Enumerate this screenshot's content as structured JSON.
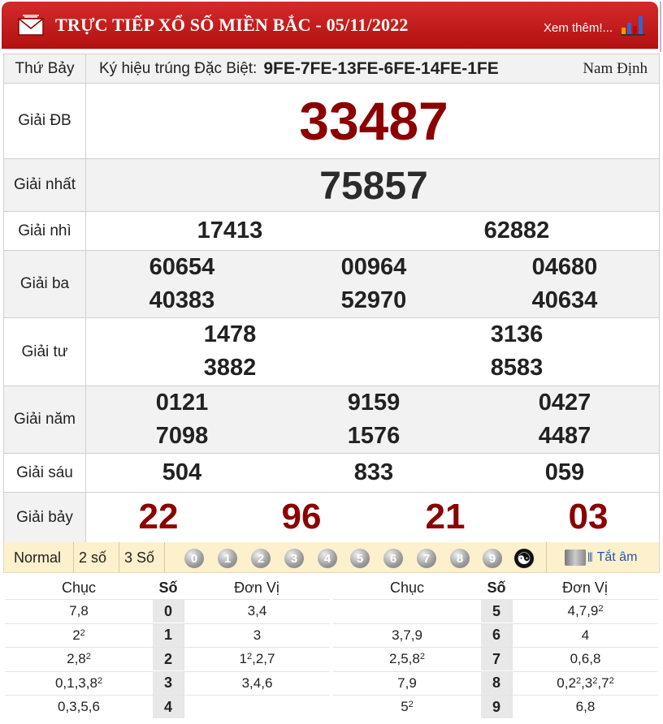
{
  "header": {
    "title": "TRỰC TIẾP XỔ SỐ MIỀN BẮC - 05/11/2022",
    "more_link": "Xem thêm!..."
  },
  "info": {
    "weekday": "Thứ Bảy",
    "symbol_label": "Ký hiệu trúng Đặc Biệt:",
    "symbol_value": "9FE-7FE-13FE-6FE-14FE-1FE",
    "province": "Nam Định"
  },
  "prizes": {
    "db": {
      "label": "Giải ĐB",
      "numbers": [
        "33487"
      ]
    },
    "nhat": {
      "label": "Giải nhất",
      "numbers": [
        "75857"
      ]
    },
    "nhi": {
      "label": "Giải nhì",
      "numbers": [
        "17413",
        "62882"
      ]
    },
    "ba": {
      "label": "Giải ba",
      "numbers": [
        "60654",
        "00964",
        "04680",
        "40383",
        "52970",
        "40634"
      ]
    },
    "tu": {
      "label": "Giải tư",
      "numbers": [
        "1478",
        "3136",
        "3882",
        "8583"
      ]
    },
    "nam": {
      "label": "Giải năm",
      "numbers": [
        "0121",
        "9159",
        "0427",
        "7098",
        "1576",
        "4487"
      ]
    },
    "sau": {
      "label": "Giải sáu",
      "numbers": [
        "504",
        "833",
        "059"
      ]
    },
    "bay": {
      "label": "Giải bảy",
      "numbers": [
        "22",
        "96",
        "21",
        "03"
      ]
    }
  },
  "toolbar": {
    "modes": [
      "Normal",
      "2 số",
      "3 Số"
    ],
    "balls": [
      "0",
      "1",
      "2",
      "3",
      "4",
      "5",
      "6",
      "7",
      "8",
      "9"
    ],
    "mute_label": "Tắt âm",
    "yinyang_icon": "yin-yang-icon",
    "mute_icon": "sound-bars-icon"
  },
  "loto": {
    "headers": {
      "chuc": "Chục",
      "so": "Số",
      "donvi": "Đơn Vị"
    },
    "left": [
      {
        "chuc": "7,8",
        "so": "0",
        "donvi": "3,4"
      },
      {
        "chuc": "2²",
        "so": "1",
        "donvi": "3"
      },
      {
        "chuc": "2,8²",
        "so": "2",
        "donvi": "1²,2,7"
      },
      {
        "chuc": "0,1,3,8²",
        "so": "3",
        "donvi": "3,4,6"
      },
      {
        "chuc": "0,3,5,6",
        "so": "4",
        "donvi": ""
      }
    ],
    "right": [
      {
        "chuc": "",
        "so": "5",
        "donvi": "4,7,9²"
      },
      {
        "chuc": "3,7,9",
        "so": "6",
        "donvi": "4"
      },
      {
        "chuc": "2,5,8²",
        "so": "7",
        "donvi": "0,6,8"
      },
      {
        "chuc": "7,9",
        "so": "8",
        "donvi": "0,2²,3²,7²"
      },
      {
        "chuc": "5²",
        "so": "9",
        "donvi": "6,8"
      }
    ]
  },
  "colors": {
    "header_red": "#c41e1e",
    "number_red": "#8b0000",
    "toolbar_bg": "#fdf0cc",
    "link_blue": "#2255aa"
  }
}
